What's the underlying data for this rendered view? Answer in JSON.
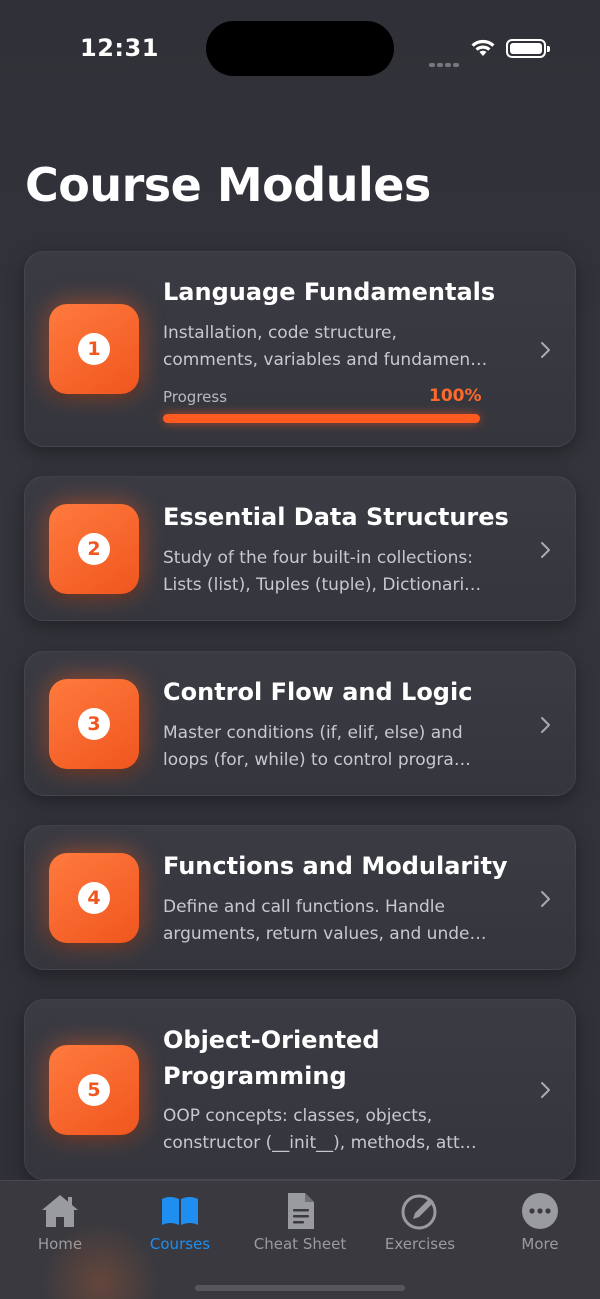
{
  "status": {
    "time": "12:31"
  },
  "page": {
    "title": "Course Modules"
  },
  "modules": [
    {
      "number": "1",
      "title": "Language Fundamentals",
      "desc_line1": "Installation, code structure,",
      "desc_line2": "comments, variables and fundamen…",
      "progress_label": "Progress",
      "progress_text": "100%",
      "progress_fraction": 1.0
    },
    {
      "number": "2",
      "title": "Essential Data Structures",
      "desc_line1": "Study of the four built-in collections:",
      "desc_line2": "Lists (list), Tuples (tuple), Dictionari…"
    },
    {
      "number": "3",
      "title": "Control Flow and Logic",
      "desc_line1": "Master conditions (if, elif, else) and",
      "desc_line2": "loops (for, while) to control progra…"
    },
    {
      "number": "4",
      "title": "Functions and Modularity",
      "desc_line1": "Define and call functions. Handle",
      "desc_line2": "arguments, return values, and unde…"
    },
    {
      "number": "5",
      "title_line1": "Object-Oriented",
      "title_line2": "Programming",
      "desc_line1": "OOP concepts: classes, objects,",
      "desc_line2": "constructor (__init__), methods, att…"
    }
  ],
  "tabs": [
    {
      "label": "Home",
      "icon": "house-icon"
    },
    {
      "label": "Courses",
      "icon": "book-icon",
      "active": true
    },
    {
      "label": "Cheat Sheet",
      "icon": "document-icon"
    },
    {
      "label": "Exercises",
      "icon": "pencil-circle-icon"
    },
    {
      "label": "More",
      "icon": "ellipsis-circle-icon"
    }
  ],
  "colors": {
    "accent": "#ff5a1f",
    "active_tab": "#1f8ef1",
    "background": "#303138"
  }
}
